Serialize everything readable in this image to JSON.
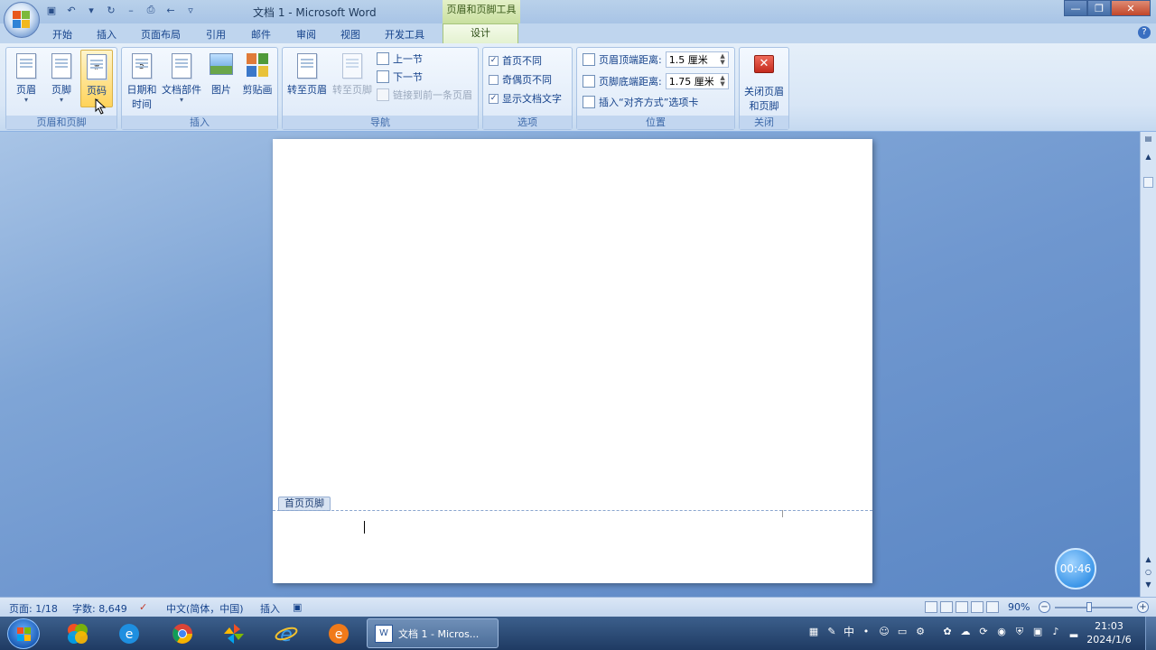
{
  "window": {
    "title": "文档 1 - Microsoft Word",
    "context_tab_group": "页眉和页脚工具"
  },
  "tabs": [
    "开始",
    "插入",
    "页面布局",
    "引用",
    "邮件",
    "审阅",
    "视图",
    "开发工具",
    "设计"
  ],
  "active_tab": "设计",
  "ribbon": {
    "group_header_footer": {
      "label": "页眉和页脚",
      "header_btn": "页眉",
      "footer_btn": "页脚",
      "page_number_btn": "页码"
    },
    "group_insert": {
      "label": "插入",
      "datetime_line1": "日期和",
      "datetime_line2": "时间",
      "quickparts": "文档部件",
      "picture": "图片",
      "clipart": "剪贴画"
    },
    "group_nav": {
      "label": "导航",
      "goto_header": "转至页眉",
      "goto_footer": "转至页脚",
      "prev_section": "上一节",
      "next_section": "下一节",
      "link_previous": "链接到前一条页眉"
    },
    "group_options": {
      "label": "选项",
      "different_first": "首页不同",
      "different_odd_even": "奇偶页不同",
      "show_doc_text": "显示文档文字",
      "different_first_checked": true,
      "different_odd_even_checked": false,
      "show_doc_text_checked": true
    },
    "group_position": {
      "label": "位置",
      "header_from_top_label": "页眉顶端距离:",
      "header_from_top_value": "1.5 厘米",
      "footer_from_bottom_label": "页脚底端距离:",
      "footer_from_bottom_value": "1.75 厘米",
      "insert_align_tab": "插入“对齐方式”选项卡"
    },
    "group_close": {
      "label": "关闭",
      "close_line1": "关闭页眉",
      "close_line2": "和页脚"
    }
  },
  "document": {
    "footer_tag": "首页页脚"
  },
  "timer": "00:46",
  "statusbar": {
    "page": "页面: 1/18",
    "words": "字数: 8,649",
    "language": "中文(简体，中国)",
    "mode": "插入",
    "zoom": "90%"
  },
  "taskbar": {
    "task_label": "文档 1 - Micros...",
    "ime": "中",
    "time": "21:03",
    "date": "2024/1/6"
  },
  "colors": {
    "accent": "#15428b",
    "context_tab": "#c9e0a0",
    "close_red": "#d23a2a"
  }
}
